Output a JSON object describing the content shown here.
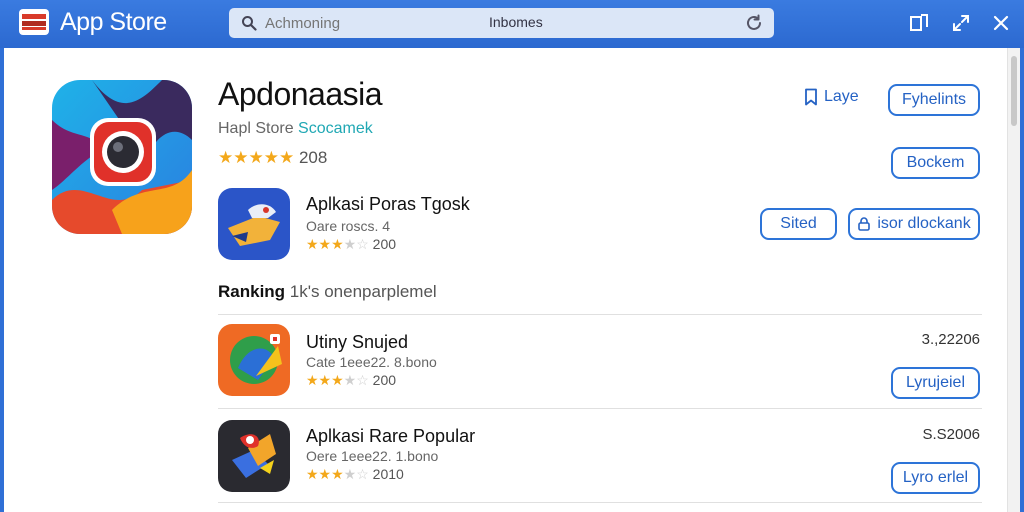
{
  "titlebar": {
    "title": "App Store",
    "search": {
      "placeholder": "Achmoning",
      "center_text": "Inbomes"
    }
  },
  "colors": {
    "accent": "#2d74d8",
    "titlebar": "#2f6fd6",
    "star": "#f3a81b",
    "subtitle_accent": "#20a8b4"
  },
  "featured": {
    "title": "Apdonaasia",
    "subtitle_prefix": "Hapl Store",
    "subtitle_accent": "Scocamek",
    "rating": 5,
    "rating_count": "208",
    "link_label": "Laye",
    "primary_button": "Fyhelints",
    "secondary_button": "Bockem"
  },
  "related": {
    "name": "Aplkasi Poras Tgosk",
    "meta": "Oare roscs. 4",
    "rating": 3.5,
    "rating_count": "200",
    "button_left": "Sited",
    "button_right": "isor dlockank"
  },
  "ranking": {
    "label": "Ranking",
    "sub": "1k's onenparplemel"
  },
  "list": [
    {
      "name": "Utiny Snujed",
      "meta": "Cate 1eee22. 8.bono",
      "rating": 3.5,
      "rating_count": "200",
      "price": "3.,22206",
      "button": "Lyrujeiel"
    },
    {
      "name": "Aplkasi Rare Popular",
      "meta": "Oere 1eee22. 1.bono",
      "rating": 3.5,
      "rating_count": "2010",
      "price": "S.S2006",
      "button": "Lyro erlel"
    }
  ],
  "icons": {
    "logo": "app-store-logo",
    "search": "search-icon",
    "refresh": "refresh-icon",
    "restore": "restore-icon",
    "expand": "expand-icon",
    "close": "close-icon",
    "bookmark": "bookmark-icon",
    "lock": "lock-icon"
  }
}
